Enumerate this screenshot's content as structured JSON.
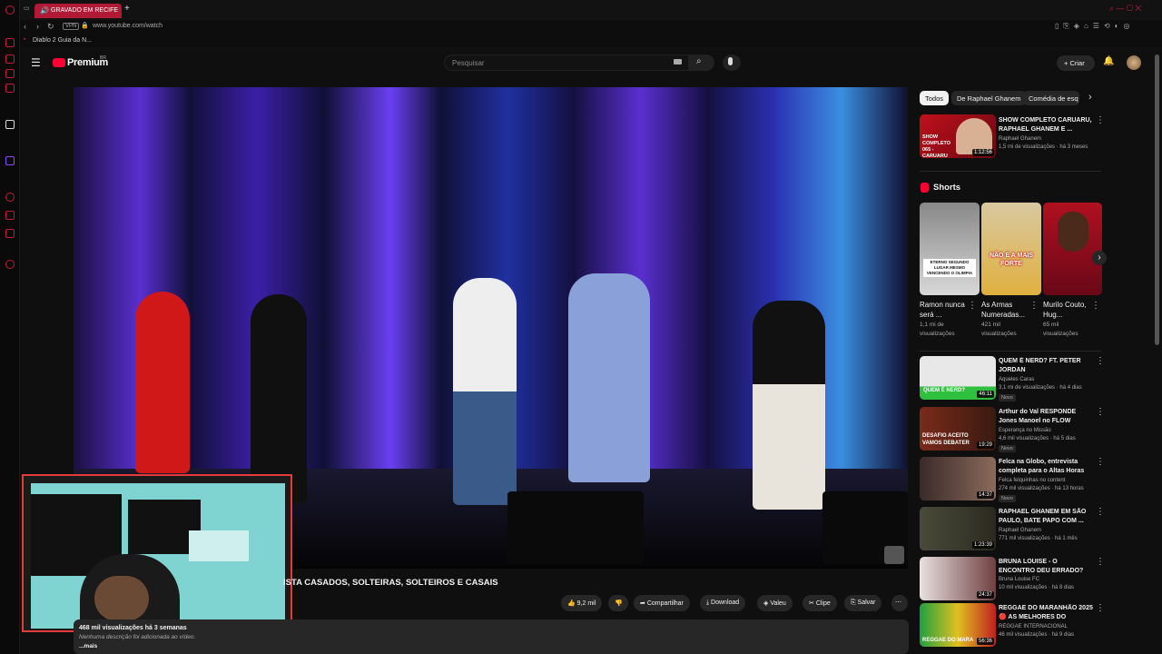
{
  "browser": {
    "tab_title": "GRAVADO EM RECIFE",
    "url": "www.youtube.com/watch",
    "vpn_label": "VPN",
    "bookmark": "Diablo 2 Guia da N..."
  },
  "header": {
    "logo_text": "Premium",
    "logo_sup": "BR",
    "search_placeholder": "Pesquisar",
    "create_label": "Criar"
  },
  "video": {
    "title": "ISTA CASADOS, SOLTEIRAS, SOLTEIROS E CASAIS",
    "likes": "9,2 mil",
    "actions": [
      "Compartilhar",
      "Download",
      "Valeu",
      "Clipe",
      "Salvar"
    ],
    "description_meta": "468 mil visualizações  há 3 semanas",
    "description_text": "Nenhuma descrição foi adicionada ao vídeo.",
    "more": "...mais"
  },
  "chips": [
    "Todos",
    "De Raphael Ghanem",
    "Comédia de esq"
  ],
  "first_video": {
    "title": "SHOW COMPLETO CARUARU, RAPHAEL GHANEM E ...",
    "channel": "Raphael Ghanem",
    "meta": "1,5 mi de visualizações · há 3 meses",
    "duration": "1:12:56",
    "thumb_text": "SHOW COMPLETO 065 - CARUARU"
  },
  "shorts": {
    "heading": "Shorts",
    "items": [
      {
        "title": "Ramon nunca será ...",
        "meta1": "1,1 mi de",
        "meta2": "visualizações",
        "thumb_text": "ETERNO SEGUNDO LUGAR MESMO VENCENDO O OLIMPIA"
      },
      {
        "title": "As Armas Numeradas...",
        "meta1": "421 mil",
        "meta2": "visualizações",
        "thumb_text": "NÃO É A MAIS FORTE"
      },
      {
        "title": "Murilo Couto, Hug...",
        "meta1": "65 mil",
        "meta2": "visualizações",
        "thumb_text": ""
      }
    ]
  },
  "videos": [
    {
      "title": "QUEM É NERD? FT. PETER JORDAN",
      "channel": "Aqueles Caras",
      "meta": "3,1 mi de visualizações · há 4 dias",
      "duration": "46:11",
      "badge": "Novo",
      "thumb_text": "QUEM É NERD?"
    },
    {
      "title": "Arthur do Val RESPONDE Jones Manoel no FLOW PODCAST",
      "channel": "Esperança no Missão",
      "meta": "4,6 mil visualizações · há 5 dias",
      "duration": "19:29",
      "badge": "Novo",
      "thumb_text": "DESAFIO ACEITO VAMOS DEBATER"
    },
    {
      "title": "Felca na Globo, entrevista completa para o Altas Horas",
      "channel": "Felca felquinhas no content",
      "meta": "274 mil visualizações · há 13 horas",
      "duration": "14:37",
      "badge": "Novo",
      "thumb_text": ""
    },
    {
      "title": "RAPHAEL GHANEM EM SÃO PAULO, BATE PAPO COM ...",
      "channel": "Raphael Ghanem",
      "meta": "771 mil visualizações · há 1 mês",
      "duration": "1:23:39",
      "badge": "",
      "thumb_text": ""
    },
    {
      "title": "BRUNA LOUISE - O ENCONTRO DEU ERRADO?",
      "channel": "Bruna Louise FC",
      "meta": "10 mil visualizações · há 8 dias",
      "duration": "24:37",
      "badge": "",
      "thumb_text": ""
    },
    {
      "title": "REGGAE DO MARANHÃO 2025 🔴 AS MELHORES DO REGGAE...",
      "channel": "REGGAE INTERNACIONAL",
      "meta": "46 mil visualizações · há 9 dias",
      "duration": "56:36",
      "badge": "",
      "thumb_text": "REGGAE DO MARA"
    }
  ],
  "colors": {
    "accent": "#c2183a",
    "yt_red": "#ff0033",
    "webcam_border": "#e53a3a"
  }
}
